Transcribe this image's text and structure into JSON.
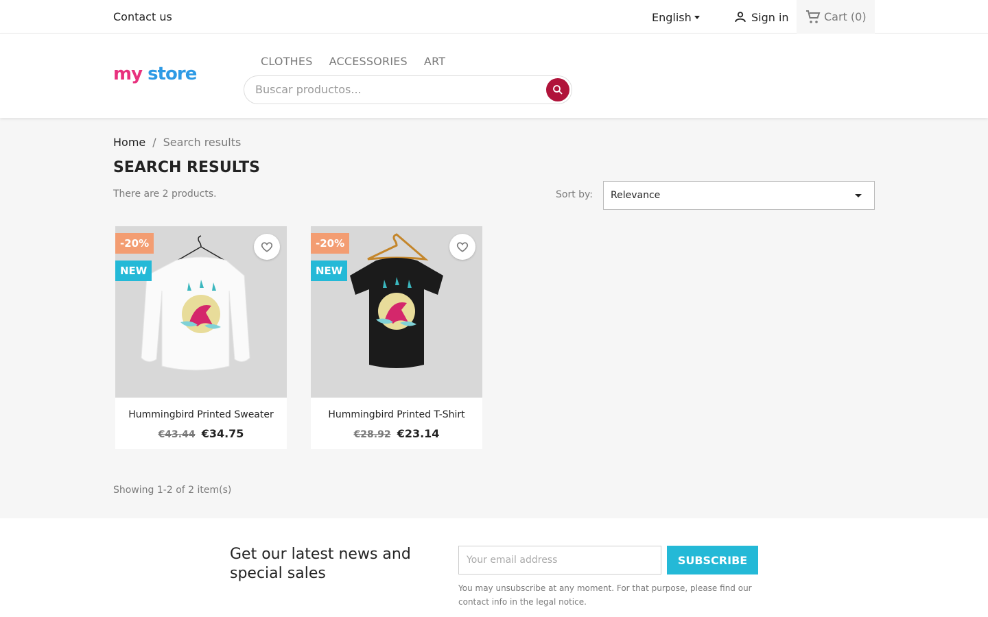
{
  "topbar": {
    "contact": "Contact us",
    "language": "English",
    "signin": "Sign in",
    "cart_label": "Cart",
    "cart_count": "(0)"
  },
  "header": {
    "logo": {
      "my": "my",
      "store": "store"
    },
    "menu": [
      "CLOTHES",
      "ACCESSORIES",
      "ART"
    ],
    "search_placeholder": "Buscar productos..."
  },
  "breadcrumb": {
    "home": "Home",
    "separator": "/",
    "current": "Search results"
  },
  "page": {
    "title": "Search results",
    "count": "There are 2 products.",
    "sort_label": "Sort by:",
    "sort_value": "Relevance",
    "showing": "Showing 1-2 of 2 item(s)"
  },
  "products": [
    {
      "name": "Hummingbird Printed Sweater",
      "old_price": "€43.44",
      "price": "€34.75",
      "discount": "-20%",
      "new": "NEW"
    },
    {
      "name": "Hummingbird Printed T-Shirt",
      "old_price": "€28.92",
      "price": "€23.14",
      "discount": "-20%",
      "new": "NEW"
    }
  ],
  "newsletter": {
    "title": "Get our latest news and special sales",
    "placeholder": "Your email address",
    "button": "SUBSCRIBE",
    "note": "You may unsubscribe at any moment. For that purpose, please find our contact info in the legal notice."
  },
  "colors": {
    "accent": "#24b9d7",
    "search_button": "#b0133a",
    "discount": "#f39d72"
  }
}
